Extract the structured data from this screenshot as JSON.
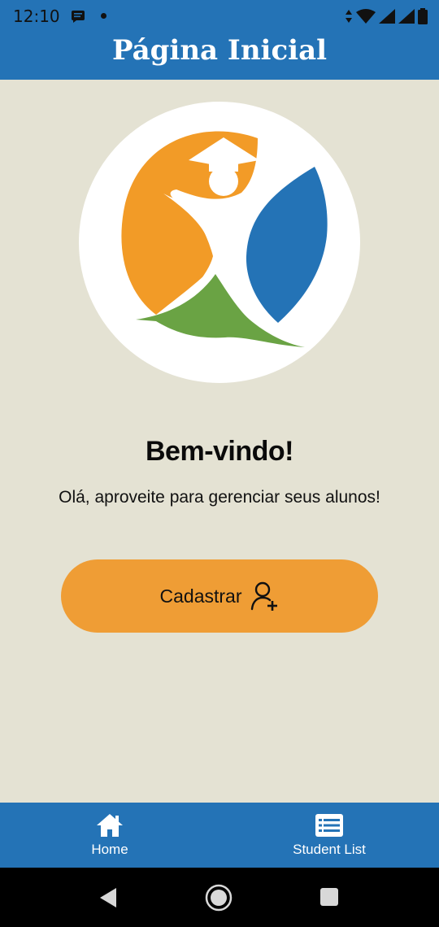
{
  "status_bar": {
    "time": "12:10",
    "icons": [
      "message-icon",
      "notification-dot-icon",
      "data-transfer-icon",
      "wifi-icon",
      "signal-icon",
      "signal-icon",
      "battery-icon"
    ]
  },
  "app_bar": {
    "title": "Página Inicial"
  },
  "logo": {
    "icon": "graduate-logo-icon",
    "colors": {
      "orange": "#f29b27",
      "green": "#6aa344",
      "blue": "#2473b6"
    }
  },
  "main": {
    "welcome": "Bem-vindo!",
    "subtitle": "Olá, aproveite para gerenciar seus alunos!",
    "register_button": {
      "label": "Cadastrar",
      "icon": "add-user-icon"
    }
  },
  "bottom_nav": {
    "items": [
      {
        "label": "Home",
        "icon": "home-icon"
      },
      {
        "label": "Student List",
        "icon": "list-icon"
      }
    ]
  },
  "system_nav": {
    "buttons": [
      "back-icon",
      "home-circle-icon",
      "recents-icon"
    ]
  },
  "colors": {
    "primary": "#2473b6",
    "accent": "#ef9d35",
    "background": "#e4e2d3"
  }
}
